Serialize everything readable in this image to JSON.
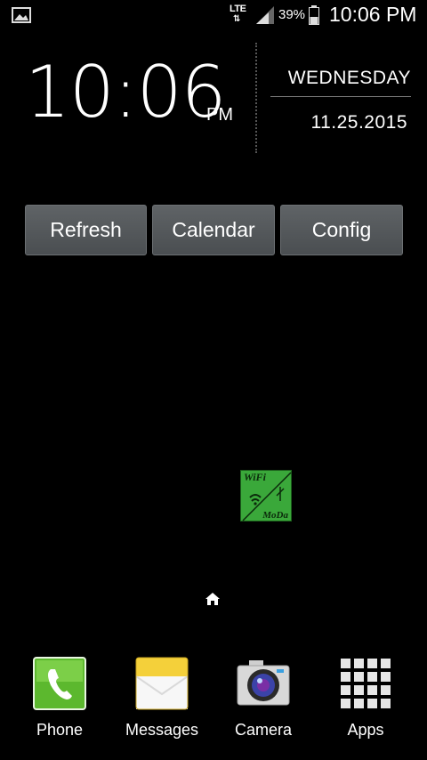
{
  "status_bar": {
    "network": "LTE",
    "battery_percent": "39%",
    "time": "10:06 PM"
  },
  "clock_widget": {
    "time": "10:06",
    "ampm": "PM",
    "day": "WEDNESDAY",
    "date": "11.25.2015"
  },
  "widget_buttons": {
    "refresh": "Refresh",
    "calendar": "Calendar",
    "config": "Config"
  },
  "home_app": {
    "line1": "WiFi",
    "line2": "MoDa",
    "icon": "wifi-moda-icon",
    "color": "#3aa83a"
  },
  "dock": {
    "items": [
      {
        "label": "Phone",
        "icon": "phone-icon"
      },
      {
        "label": "Messages",
        "icon": "messages-icon"
      },
      {
        "label": "Camera",
        "icon": "camera-icon"
      },
      {
        "label": "Apps",
        "icon": "apps-grid-icon"
      }
    ]
  }
}
